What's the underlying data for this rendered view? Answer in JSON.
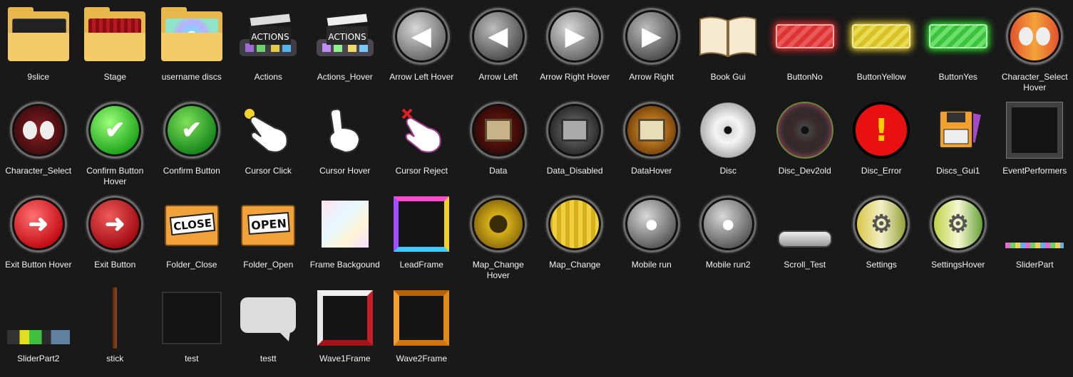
{
  "items": [
    {
      "label": "9slice",
      "icon": "folder-icon"
    },
    {
      "label": "Stage",
      "icon": "folder-icon"
    },
    {
      "label": "username discs",
      "icon": "folder-icon"
    },
    {
      "label": "Actions",
      "icon": "clapperboard-icon"
    },
    {
      "label": "Actions_Hover",
      "icon": "clapperboard-icon"
    },
    {
      "label": "Arrow Left Hover",
      "icon": "arrow-left-icon"
    },
    {
      "label": "Arrow Left",
      "icon": "arrow-left-icon"
    },
    {
      "label": "Arrow Right Hover",
      "icon": "arrow-right-icon"
    },
    {
      "label": "Arrow Right",
      "icon": "arrow-right-icon"
    },
    {
      "label": "Book Gui",
      "icon": "book-icon"
    },
    {
      "label": "ButtonNo",
      "icon": "red-button-icon"
    },
    {
      "label": "ButtonYellow",
      "icon": "yellow-button-icon"
    },
    {
      "label": "ButtonYes",
      "icon": "green-button-icon"
    },
    {
      "label": "Character_Select Hover",
      "icon": "character-orb-icon"
    },
    {
      "label": "Character_Select",
      "icon": "character-orb-icon"
    },
    {
      "label": "Confirm Button Hover",
      "icon": "confirm-orb-icon"
    },
    {
      "label": "Confirm Button",
      "icon": "confirm-orb-icon"
    },
    {
      "label": "Cursor Click",
      "icon": "hand-cursor-icon"
    },
    {
      "label": "Cursor Hover",
      "icon": "hand-cursor-icon"
    },
    {
      "label": "Cursor Reject",
      "icon": "hand-cursor-icon"
    },
    {
      "label": "Data",
      "icon": "computer-orb-icon"
    },
    {
      "label": "Data_Disabled",
      "icon": "computer-orb-icon"
    },
    {
      "label": "DataHover",
      "icon": "computer-orb-icon"
    },
    {
      "label": "Disc",
      "icon": "disc-icon"
    },
    {
      "label": "Disc_Dev2old",
      "icon": "disc-icon"
    },
    {
      "label": "Disc_Error",
      "icon": "error-icon"
    },
    {
      "label": "Discs_Gui1",
      "icon": "floppy-disk-icon"
    },
    {
      "label": "EventPerformers",
      "icon": "frame-icon"
    },
    {
      "label": "Exit Button Hover",
      "icon": "exit-orb-icon"
    },
    {
      "label": "Exit Button",
      "icon": "exit-orb-icon"
    },
    {
      "label": "Folder_Close",
      "icon": "folder-close-icon",
      "sign": "CLOSE"
    },
    {
      "label": "Folder_Open",
      "icon": "folder-open-icon",
      "sign": "OPEN"
    },
    {
      "label": "Frame Backgound",
      "icon": "pastel-texture-icon"
    },
    {
      "label": "LeadFrame",
      "icon": "frame-icon"
    },
    {
      "label": "Map_Change Hover",
      "icon": "curtain-orb-icon"
    },
    {
      "label": "Map_Change",
      "icon": "curtain-orb-icon"
    },
    {
      "label": "Mobile run",
      "icon": "runner-orb-icon"
    },
    {
      "label": "Mobile run2",
      "icon": "runner-orb-icon"
    },
    {
      "label": "Scroll_Test",
      "icon": "scroll-pill-icon"
    },
    {
      "label": "Settings",
      "icon": "gear-orb-icon"
    },
    {
      "label": "SettingsHover",
      "icon": "gear-orb-icon"
    },
    {
      "label": "SliderPart",
      "icon": "slider-strip-icon"
    },
    {
      "label": "SliderPart2",
      "icon": "slider-strip-icon"
    },
    {
      "label": "stick",
      "icon": "stick-icon"
    },
    {
      "label": "test",
      "icon": "dark-square-icon"
    },
    {
      "label": "testt",
      "icon": "speech-bubble-icon"
    },
    {
      "label": "Wave1Frame",
      "icon": "frame-icon"
    },
    {
      "label": "Wave2Frame",
      "icon": "frame-icon"
    }
  ]
}
